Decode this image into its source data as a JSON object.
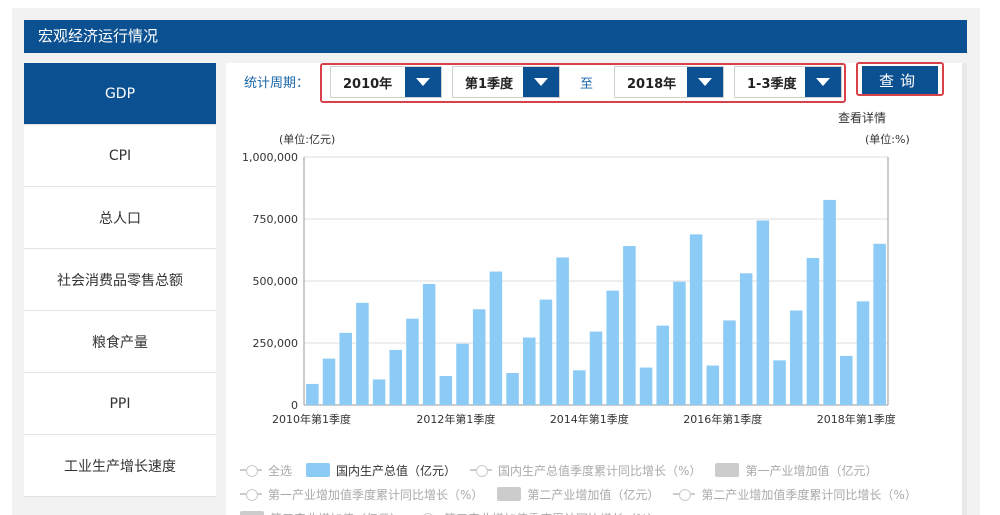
{
  "header": {
    "title": "宏观经济运行情况"
  },
  "sidebar": {
    "items": [
      {
        "label": "GDP",
        "active": true
      },
      {
        "label": "CPI"
      },
      {
        "label": "总人口"
      },
      {
        "label": "社会消费品零售总额"
      },
      {
        "label": "粮食产量"
      },
      {
        "label": "PPI"
      },
      {
        "label": "工业生产增长速度"
      }
    ]
  },
  "filters": {
    "period_label": "统计周期：",
    "start_year": "2010年",
    "start_quarter": "第1季度",
    "to_label": "至",
    "end_year": "2018年",
    "end_quarter": "1-3季度",
    "query_label": "查询"
  },
  "detail_link": "查看详情",
  "unit_left": "(单位:亿元)",
  "unit_right": "(单位:%)",
  "colors": {
    "primary": "#0b5090",
    "bar": "#8ccbf5",
    "highlight_outline": "#d9414a"
  },
  "chart_data": {
    "type": "bar",
    "ylim": [
      0,
      1000000
    ],
    "yticks": [
      "0",
      "250,000",
      "500,000",
      "750,000",
      "1,000,000"
    ],
    "xtick_labels": [
      "2010年第1季度",
      "2012年第1季度",
      "2014年第1季度",
      "2016年第1季度",
      "2018年第1季度"
    ],
    "categories": [
      "2010年第1季度",
      "2010年1-2季度",
      "2010年1-3季度",
      "2010年1-4季度",
      "2011年第1季度",
      "2011年1-2季度",
      "2011年1-3季度",
      "2011年1-4季度",
      "2012年第1季度",
      "2012年1-2季度",
      "2012年1-3季度",
      "2012年1-4季度",
      "2013年第1季度",
      "2013年1-2季度",
      "2013年1-3季度",
      "2013年1-4季度",
      "2014年第1季度",
      "2014年1-2季度",
      "2014年1-3季度",
      "2014年1-4季度",
      "2015年第1季度",
      "2015年1-2季度",
      "2015年1-3季度",
      "2015年1-4季度",
      "2016年第1季度",
      "2016年1-2季度",
      "2016年1-3季度",
      "2016年1-4季度",
      "2017年第1季度",
      "2017年1-2季度",
      "2017年1-3季度",
      "2017年1-4季度",
      "2018年第1季度",
      "2018年1-2季度",
      "2018年1-3季度"
    ],
    "series": [
      {
        "name": "国内生产总值（亿元）",
        "values": [
          85000,
          187000,
          291000,
          412000,
          103000,
          222000,
          348000,
          488000,
          117000,
          247000,
          386000,
          538000,
          129000,
          272000,
          425000,
          595000,
          140000,
          296000,
          461000,
          641000,
          151000,
          320000,
          497000,
          688000,
          159000,
          341000,
          531000,
          744000,
          180000,
          381000,
          593000,
          827000,
          198000,
          418000,
          650000
        ]
      }
    ],
    "legend": {
      "row1": [
        {
          "label": "全选",
          "kind": "line",
          "on": false
        },
        {
          "label": "国内生产总值（亿元）",
          "kind": "box",
          "on": true
        },
        {
          "label": "国内生产总值季度累计同比增长（%）",
          "kind": "line",
          "on": false
        },
        {
          "label": "第一产业增加值（亿元）",
          "kind": "box",
          "on": false
        }
      ],
      "row2": [
        {
          "label": "第一产业增加值季度累计同比增长（%）",
          "kind": "line",
          "on": false
        },
        {
          "label": "第二产业增加值（亿元）",
          "kind": "box",
          "on": false
        },
        {
          "label": "第二产业增加值季度累计同比增长（%）",
          "kind": "line",
          "on": false
        }
      ],
      "row3": [
        {
          "label": "第三产业增加值（亿元）",
          "kind": "box",
          "on": false
        },
        {
          "label": "第三产业增加值季度累计同比增长（%）",
          "kind": "line",
          "on": false
        }
      ]
    }
  }
}
